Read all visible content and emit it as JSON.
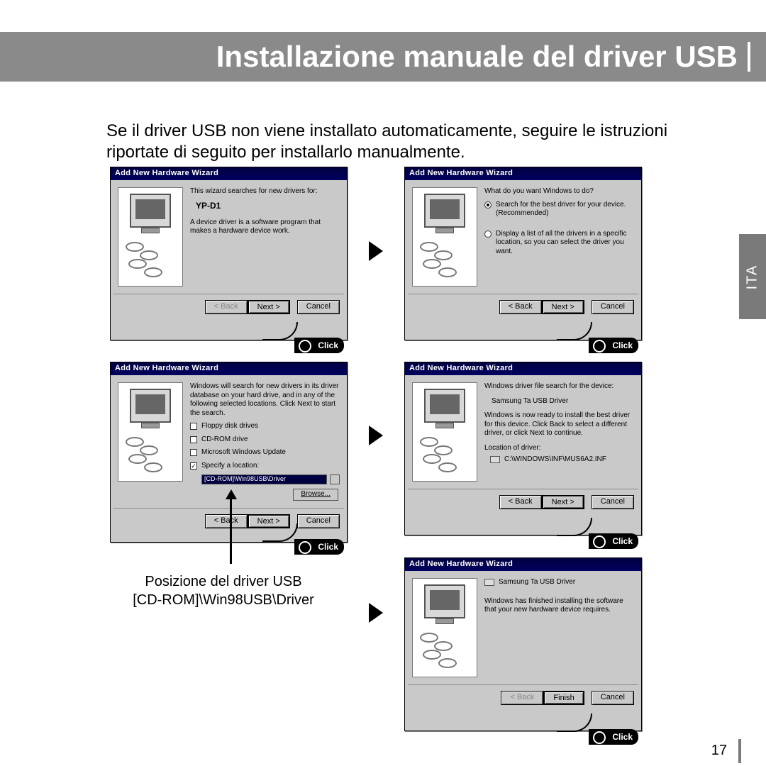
{
  "header": {
    "title": "Installazione manuale del driver USB"
  },
  "intro": "Se il driver USB non viene installato automaticamente, seguire le istruzioni riportate di seguito per installarlo manualmente.",
  "side_tab": "ITA",
  "page_number": "17",
  "click_label": "Click",
  "callout": {
    "line1": "Posizione del driver USB",
    "line2": "[CD-ROM]\\Win98USB\\Driver"
  },
  "wizards": {
    "title": "Add New Hardware Wizard",
    "buttons": {
      "back": "< Back",
      "next": "Next >",
      "cancel": "Cancel",
      "browse": "Browse...",
      "finish": "Finish"
    },
    "w1": {
      "line1": "This wizard searches for new drivers for:",
      "device": "YP-D1",
      "line2": "A device driver is a software program that makes a hardware device work."
    },
    "w2": {
      "line1": "What do you want Windows to do?",
      "opt1": "Search for the best driver for your device. (Recommended)",
      "opt2": "Display a list of all the drivers in a specific location, so you can select the driver you want."
    },
    "w3": {
      "line1": "Windows will search for new drivers in its driver database on your hard drive, and in any of the following selected locations. Click Next to start the search.",
      "opt1": "Floppy disk drives",
      "opt2": "CD-ROM drive",
      "opt3": "Microsoft Windows Update",
      "opt4": "Specify a location:",
      "path": "[CD-ROM]\\Win98USB\\Driver"
    },
    "w4": {
      "device": "Samsung Ta USB Driver",
      "line1": "Windows driver file search for the device:",
      "line2": "Windows is now ready to install the best driver for this device. Click Back to select a different driver, or click Next to continue.",
      "loc_label": "Location of driver:",
      "loc_path": "C:\\WINDOWS\\INF\\MUS6A2.INF"
    },
    "w5": {
      "device": "Samsung Ta USB Driver",
      "line1": "Windows has finished installing the software that your new hardware device requires."
    }
  }
}
